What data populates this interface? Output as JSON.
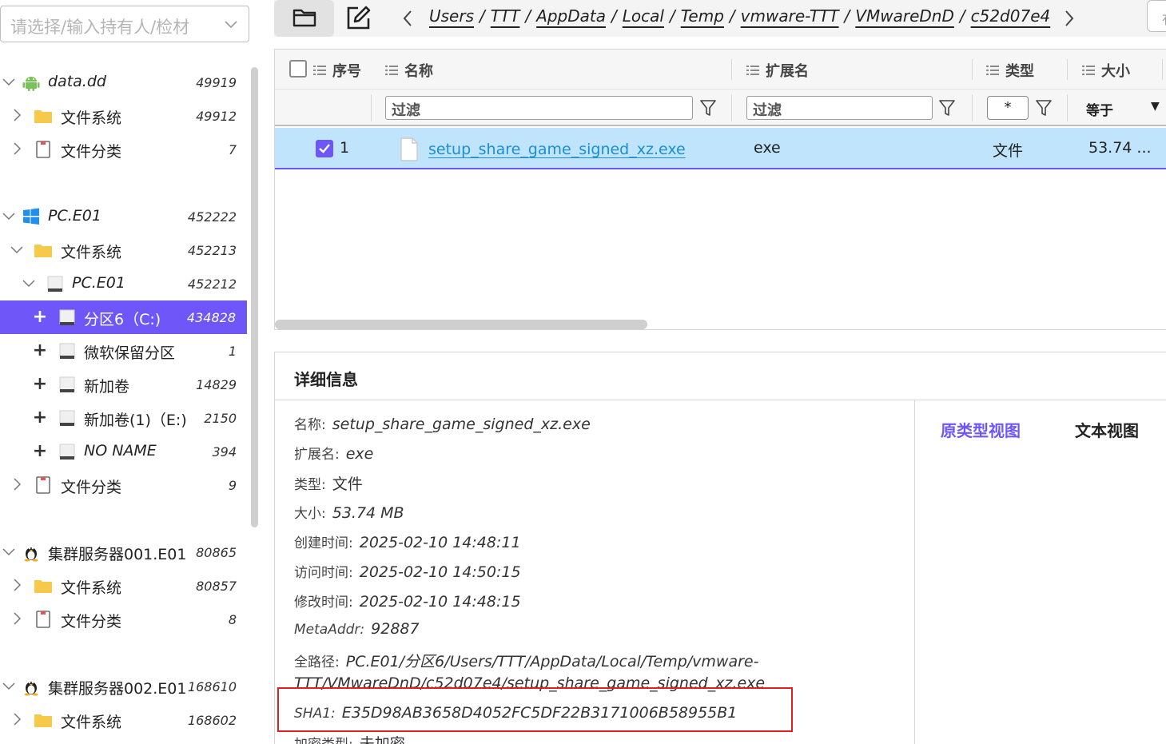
{
  "case_selector": {
    "placeholder": "请选择/输入持有人/检材"
  },
  "tree": [
    {
      "label": "data.dd",
      "count": "49919",
      "icon": "android-icon"
    },
    {
      "label": "文件系统",
      "count": "49912",
      "icon": "folder-icon"
    },
    {
      "label": "文件分类",
      "count": "7",
      "icon": "document-icon"
    },
    {
      "label": "PC.E01",
      "count": "452222",
      "icon": "windows-icon"
    },
    {
      "label": "文件系统",
      "count": "452213",
      "icon": "folder-icon"
    },
    {
      "label": "PC.E01",
      "count": "452212",
      "icon": "disk-icon"
    },
    {
      "label": "分区6（C:)",
      "count": "434828",
      "icon": "disk-icon"
    },
    {
      "label": "微软保留分区",
      "count": "1",
      "icon": "disk-icon"
    },
    {
      "label": "新加卷",
      "count": "14829",
      "icon": "disk-icon"
    },
    {
      "label": "新加卷(1)（E:)",
      "count": "2150",
      "icon": "disk-icon"
    },
    {
      "label": "NO NAME",
      "count": "394",
      "icon": "disk-icon"
    },
    {
      "label": "文件分类",
      "count": "9",
      "icon": "document-icon"
    },
    {
      "label": "集群服务器001.E01",
      "count": "80865",
      "icon": "linux-icon"
    },
    {
      "label": "文件系统",
      "count": "80857",
      "icon": "folder-icon"
    },
    {
      "label": "文件分类",
      "count": "8",
      "icon": "document-icon"
    },
    {
      "label": "集群服务器002.E01",
      "count": "168610",
      "icon": "linux-icon"
    },
    {
      "label": "文件系统",
      "count": "168602",
      "icon": "folder-icon"
    }
  ],
  "breadcrumb": [
    "Users",
    "TTT",
    "AppData",
    "Local",
    "Temp",
    "vmware-TTT",
    "VMwareDnD",
    "c52d07e4"
  ],
  "corner_btn": "有",
  "table": {
    "columns": {
      "index": "序号",
      "name": "名称",
      "ext": "扩展名",
      "type": "类型",
      "size": "大小"
    },
    "filter_placeholder": "过滤",
    "type_filter": "*",
    "size_operator": "等于",
    "rows": [
      {
        "index": "1",
        "name": "setup_share_game_signed_xz.exe",
        "ext": "exe",
        "type": "文件",
        "size": "53.74 ..."
      }
    ]
  },
  "details": {
    "title": "详细信息",
    "fields": [
      {
        "key": "名称:",
        "value": "setup_share_game_signed_xz.exe"
      },
      {
        "key": "扩展名:",
        "value": "exe"
      },
      {
        "key": "类型:",
        "value": "文件"
      },
      {
        "key": "大小:",
        "value": "53.74 MB"
      },
      {
        "key": "创建时间:",
        "value": "2025-02-10 14:48:11"
      },
      {
        "key": "访问时间:",
        "value": "2025-02-10 14:50:15"
      },
      {
        "key": "修改时间:",
        "value": "2025-02-10 14:48:15"
      },
      {
        "key": "MetaAddr:",
        "value": "92887"
      },
      {
        "key": "全路径:",
        "value": "PC.E01/分区6/Users/TTT/AppData/Local/Temp/vmware-",
        "value2": "TTT/VMwareDnD/c52d07e4/setup_share_game_signed_xz.exe"
      },
      {
        "key": "SHA1:",
        "value": "E35D98AB3658D4052FC5DF22B3171006B58955B1"
      },
      {
        "key": "加密类型:",
        "value": "未加密"
      }
    ],
    "tabs": {
      "raw": "原类型视图",
      "text": "文本视图"
    }
  },
  "colors": {
    "accent": "#6e56f8",
    "selection_row": "#bfe4fb",
    "link": "#1a8fd4",
    "highlight_box": "#e01f1f"
  }
}
